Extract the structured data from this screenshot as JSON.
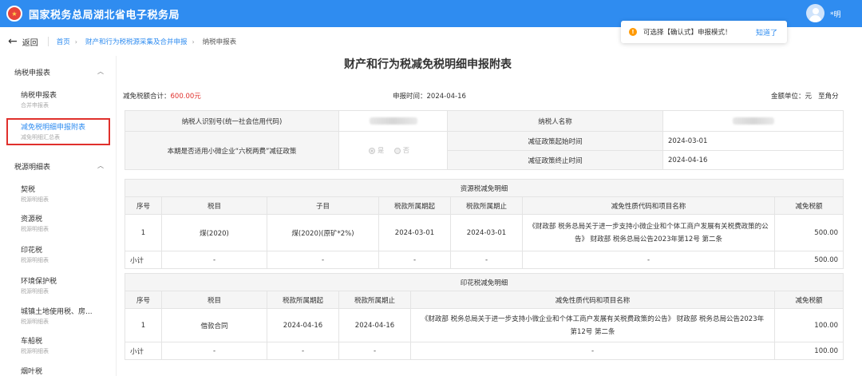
{
  "header": {
    "logo_glyph": "★",
    "title": "国家税务总局湖北省电子税务局",
    "user_name": "*明"
  },
  "nav": {
    "back_label": "返回",
    "breadcrumbs": [
      "首页",
      "财产和行为税税源采集及合并申报",
      "纳税申报表"
    ]
  },
  "toast": {
    "icon": "!",
    "text": "可选择【确认式】申报模式！",
    "button": "知道了"
  },
  "sidebar": {
    "groups": [
      {
        "title": "纳税申报表",
        "items": [
          {
            "label": "纳税申报表",
            "sub": "合并申报表"
          },
          {
            "label": "减免税明细申报附表",
            "sub": "减免明细汇总表"
          }
        ]
      },
      {
        "title": "税源明细表",
        "items": [
          {
            "label": "契税",
            "sub": "税源明细表"
          },
          {
            "label": "资源税",
            "sub": "税源明细表"
          },
          {
            "label": "印花税",
            "sub": "税源明细表"
          },
          {
            "label": "环境保护税",
            "sub": "税源明细表"
          },
          {
            "label": "城镇土地使用税、房...",
            "sub": "税源明细表"
          },
          {
            "label": "车船税",
            "sub": "税源明细表"
          },
          {
            "label": "烟叶税"
          }
        ]
      }
    ]
  },
  "main": {
    "title": "财产和行为税减免税明细申报附表",
    "summary": {
      "total_label": "减免税额合计：",
      "total_value": "600.00元",
      "date_label": "申报时间：",
      "date_value": "2024-04-16",
      "unit_label": "金额单位：元",
      "unit_suffix": "至角分"
    },
    "info": {
      "taxpayer_id_label": "纳税人识别号(统一社会信用代码)",
      "taxpayer_name_label": "纳税人名称",
      "small_biz_label": "本期是否适用小微企业“六税两费”减征政策",
      "radio_yes": "是",
      "radio_no": "否",
      "start_label": "减征政策起始时间",
      "start_value": "2024-03-01",
      "end_label": "减征政策终止时间",
      "end_value": "2024-04-16"
    },
    "resource": {
      "title": "资源税减免明细",
      "headers": [
        "序号",
        "税目",
        "子目",
        "税款所属期起",
        "税款所属期止",
        "减免性质代码和项目名称",
        "减免税额"
      ],
      "rows": [
        {
          "no": "1",
          "item": "煤(2020)",
          "subitem": "煤(2020)(原矿*2%)",
          "start": "2024-03-01",
          "end": "2024-03-01",
          "nature": "《财政部 税务总局关于进一步支持小微企业和个体工商户发展有关税费政策的公告》 财政部 税务总局公告2023年第12号 第二条",
          "amount": "500.00"
        }
      ],
      "subtotal": {
        "label": "小计",
        "dash": "-",
        "amount": "500.00"
      }
    },
    "stamp": {
      "title": "印花税减免明细",
      "headers": [
        "序号",
        "税目",
        "税款所属期起",
        "税款所属期止",
        "减免性质代码和项目名称",
        "减免税额"
      ],
      "rows": [
        {
          "no": "1",
          "item": "借款合同",
          "start": "2024-04-16",
          "end": "2024-04-16",
          "nature": "《财政部 税务总局关于进一步支持小微企业和个体工商户发展有关税费政策的公告》 财政部 税务总局公告2023年第12号 第二条",
          "amount": "100.00"
        }
      ],
      "subtotal": {
        "label": "小计",
        "dash": "-",
        "amount": "100.00"
      }
    }
  },
  "colors": {
    "brand": "#2f8cf0",
    "highlight": "#e0302c",
    "toast_icon": "#ff9900"
  }
}
